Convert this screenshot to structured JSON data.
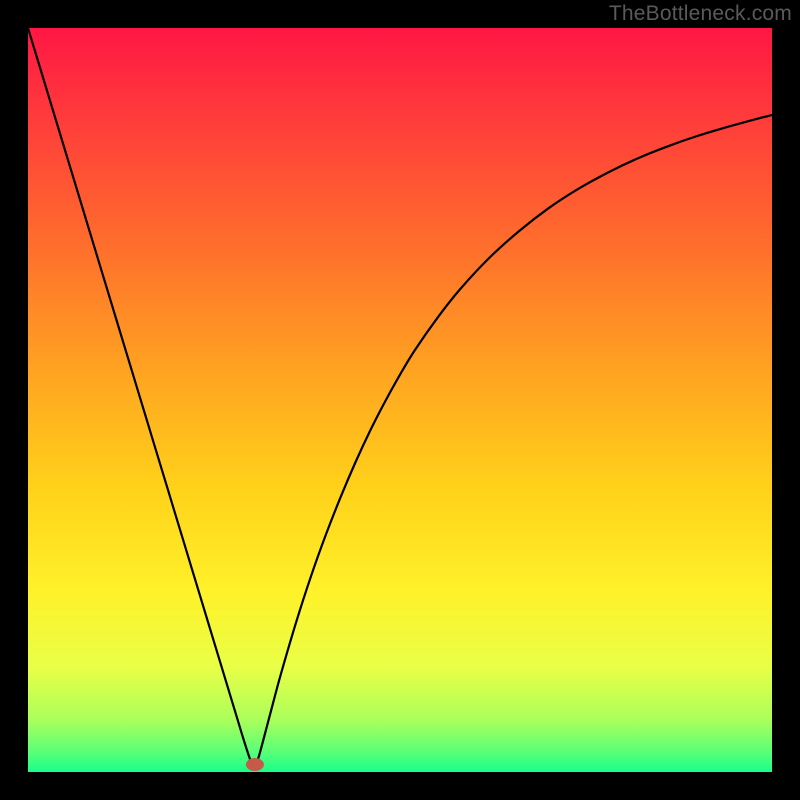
{
  "watermark": "TheBottleneck.com",
  "chart_data": {
    "type": "line",
    "title": "",
    "xlabel": "",
    "ylabel": "",
    "xlim": [
      0,
      100
    ],
    "ylim": [
      0,
      100
    ],
    "grid": false,
    "legend": false,
    "background_gradient": {
      "stops": [
        {
          "offset": 0.0,
          "color": "#ff1744"
        },
        {
          "offset": 0.12,
          "color": "#ff3b3b"
        },
        {
          "offset": 0.28,
          "color": "#ff6a2d"
        },
        {
          "offset": 0.46,
          "color": "#ffa321"
        },
        {
          "offset": 0.62,
          "color": "#ffd21a"
        },
        {
          "offset": 0.76,
          "color": "#fff22a"
        },
        {
          "offset": 0.86,
          "color": "#e8ff47"
        },
        {
          "offset": 0.93,
          "color": "#aaff5a"
        },
        {
          "offset": 0.975,
          "color": "#55ff79"
        },
        {
          "offset": 1.0,
          "color": "#18ff8a"
        }
      ]
    },
    "marker": {
      "x": 30.5,
      "y": 1.0,
      "color": "#c65a48"
    },
    "series": [
      {
        "name": "curve",
        "color": "#000000",
        "x": [
          0,
          2,
          4,
          6,
          8,
          10,
          12,
          14,
          16,
          18,
          20,
          22,
          24,
          26,
          28,
          29,
          30,
          30.5,
          31,
          32,
          33,
          34,
          36,
          38,
          40,
          42,
          44,
          46,
          48,
          50,
          52,
          55,
          58,
          62,
          66,
          70,
          74,
          78,
          82,
          86,
          90,
          94,
          98,
          100
        ],
        "y": [
          100,
          93.4,
          86.8,
          80.2,
          73.6,
          67,
          60.4,
          53.8,
          47.2,
          40.6,
          34,
          27.4,
          20.8,
          14.2,
          7.6,
          4.3,
          1.3,
          0.7,
          2.0,
          5.7,
          9.5,
          13.2,
          20.0,
          26.2,
          31.8,
          36.9,
          41.6,
          45.9,
          49.8,
          53.4,
          56.7,
          61.0,
          64.8,
          69.1,
          72.7,
          75.8,
          78.4,
          80.6,
          82.5,
          84.1,
          85.5,
          86.7,
          87.8,
          88.3
        ]
      }
    ]
  }
}
